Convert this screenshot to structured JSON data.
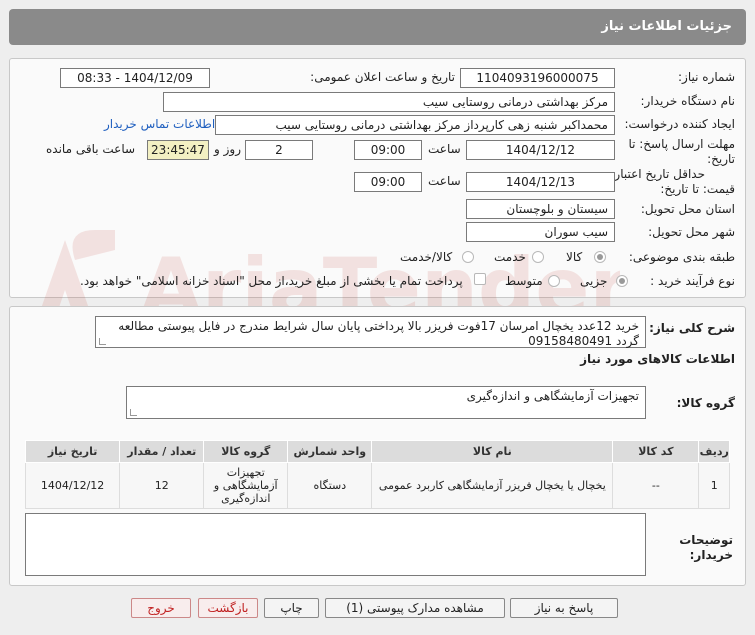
{
  "header": {
    "title": "جزئیات اطلاعات نیاز"
  },
  "form": {
    "need_number_label": "شماره نیاز:",
    "need_number": "1104093196000075",
    "announce_label": "تاریخ و ساعت اعلان عمومی:",
    "announce_value": "1404/12/09 - 08:33",
    "buyer_org_label": "نام دستگاه خریدار:",
    "buyer_org": "مرکز بهداشتی درمانی روستایی سیب",
    "creator_label": "ایجاد کننده درخواست:",
    "creator": "محمداکبر شنبه زهی کارپرداز مرکز بهداشتی درمانی روستایی سیب",
    "contact_link": "اطلاعات تماس خریدار",
    "deadline_label_1": "مهلت ارسال پاسخ: تا",
    "deadline_label_2": "تاریخ:",
    "deadline_date": "1404/12/12",
    "time_label": "ساعت",
    "deadline_time": "09:00",
    "day_count": "2",
    "day_label": "روز و",
    "remaining_time": "23:45:47",
    "remaining_label": "ساعت باقی مانده",
    "validity_label_1": "حداقل تاریخ اعتبار",
    "validity_label_2": "قیمت: تا تاریخ:",
    "validity_date": "1404/12/13",
    "validity_time": "09:00",
    "province_label": "استان محل تحویل:",
    "province": "سیستان و بلوچستان",
    "city_label": "شهر محل تحویل:",
    "city": "سیب سوران",
    "category_label": "طبقه بندی موضوعی:",
    "category_options": [
      "کالا",
      "خدمت",
      "کالا/خدمت"
    ],
    "category_selected": "کالا",
    "process_label": "نوع فرآیند خرید :",
    "process_options": [
      "جزیی",
      "متوسط"
    ],
    "process_selected": "جزیی",
    "payment_note": "پرداخت تمام یا بخشی از مبلغ خرید،از محل \"اسناد خزانه اسلامی\" خواهد بود."
  },
  "description": {
    "label": "شرح کلی نیاز:",
    "text": "خرید 12عدد یخچال امرسان 17فوت فریزر بالا پرداختی پایان سال شرایط مندرج در فایل پیوستی مطالعه گردد 09158480491"
  },
  "goods": {
    "section_title": "اطلاعات کالاهای مورد نیاز",
    "group_label": "گروه کالا:",
    "group_value": "تجهیزات آزمایشگاهی و اندازه‌گیری",
    "columns": [
      "ردیف",
      "کد کالا",
      "نام کالا",
      "واحد شمارش",
      "گروه کالا",
      "تعداد / مقدار",
      "تاریخ نیاز"
    ],
    "rows": [
      [
        "1",
        "--",
        "یخچال یا یخچال فریزر آزمایشگاهی کاربرد عمومی",
        "دستگاه",
        "تجهیزات آزمایشگاهی و اندازه‌گیری",
        "12",
        "1404/12/12"
      ]
    ]
  },
  "buyer_notes": {
    "label_1": "توضیحات",
    "label_2": "خریدار:",
    "text": ""
  },
  "buttons": {
    "reply": "پاسخ به نیاز",
    "attachments": "مشاهده مدارک پیوستی (1)",
    "print": "چاپ",
    "back": "بازگشت",
    "exit": "خروج"
  },
  "colors": {
    "header_bg": "#8a8a8a",
    "remaining_bg": "#f3f0c3",
    "link": "#1f5fbf",
    "exit_text": "#c02020"
  }
}
